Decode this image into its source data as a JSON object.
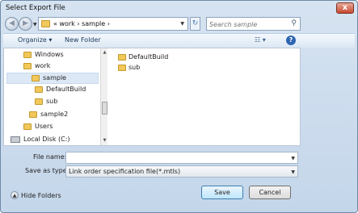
{
  "window": {
    "title": "Select Export File",
    "close_label": "x"
  },
  "nav": {
    "back_icon": "back-arrow-icon",
    "forward_icon": "forward-arrow-icon",
    "address_text": "« work › sample ›",
    "search_placeholder": "Search sample"
  },
  "toolbar": {
    "organize_label": "Organize ▾",
    "new_folder_label": "New Folder"
  },
  "tree": {
    "items": [
      {
        "label": "Windows"
      },
      {
        "label": "work"
      },
      {
        "label": "sample"
      },
      {
        "label": "DefaultBuild"
      },
      {
        "label": "sub"
      },
      {
        "label": "sample2"
      },
      {
        "label": "Users"
      },
      {
        "label": "Local Disk (C:)"
      }
    ]
  },
  "files": {
    "items": [
      {
        "label": "DefaultBuild"
      },
      {
        "label": "sub"
      }
    ]
  },
  "form": {
    "file_name_label": "File name:",
    "file_name_value": "",
    "save_as_type_label": "Save as type:",
    "save_as_type_value": "Link order specification file(*.mtls)"
  },
  "footer": {
    "hide_folders_label": "Hide Folders",
    "save_label": "Save",
    "cancel_label": "Cancel"
  },
  "colors": {
    "title_bar": "#d6e3f1",
    "selection": "#dde8f6",
    "folder": "#f2c85a"
  }
}
